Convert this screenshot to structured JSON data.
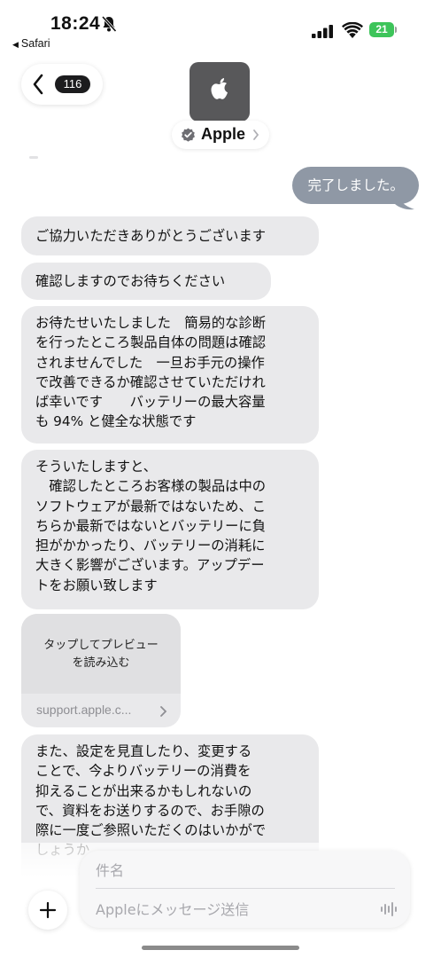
{
  "status_bar": {
    "time": "18:24",
    "back_app": "Safari",
    "battery": "21"
  },
  "header": {
    "unread_count": "116",
    "contact_name": "Apple"
  },
  "messages": {
    "outgoing_1": "完了しました。",
    "incoming_1": "ご協力いただきありがとうございます",
    "incoming_2": "確認しますのでお待ちください",
    "incoming_3": "お待たせいたしました　簡易的な診断\nを行ったところ製品自体の問題は確認\nされませんでした　一旦お手元の操作\nで改善できるか確認させていただけれ\nば幸いです　　バッテリーの最大容量\nも 94% と健全な状態です",
    "incoming_4": "そういたしますと、\n　確認したところお客様の製品は中の\nソフトウェアが最新ではないため、こ\nちらか最新ではないとバッテリーに負\n担がかかったり、バッテリーの消耗に\n大きく影響がございます。アップデー\nトをお願い致します",
    "link_preview_text": "タップしてプレビュー\nを読み込む",
    "link_domain": "support.apple.c...",
    "incoming_6": "また、設定を見直したり、変更する\nことで、今よりバッテリーの消費を\n抑えることが出来るかもしれないの\nで、資料をお送りするので、お手隙の\n際に一度ご参照いただくのはいかがで\nしょうか"
  },
  "composer": {
    "subject_placeholder": "件名",
    "message_placeholder": "Appleにメッセージ送信"
  },
  "colors": {
    "outgoing_bubble": "#8f98a5",
    "incoming_bubble": "#e9e9eb",
    "battery": "#3dc45a"
  },
  "icons": [
    "bell-slash-icon",
    "signal-icon",
    "wifi-icon",
    "battery-icon",
    "chevron-left-icon",
    "apple-logo-icon",
    "verified-icon",
    "chevron-right-icon",
    "plus-icon",
    "waveform-icon"
  ]
}
